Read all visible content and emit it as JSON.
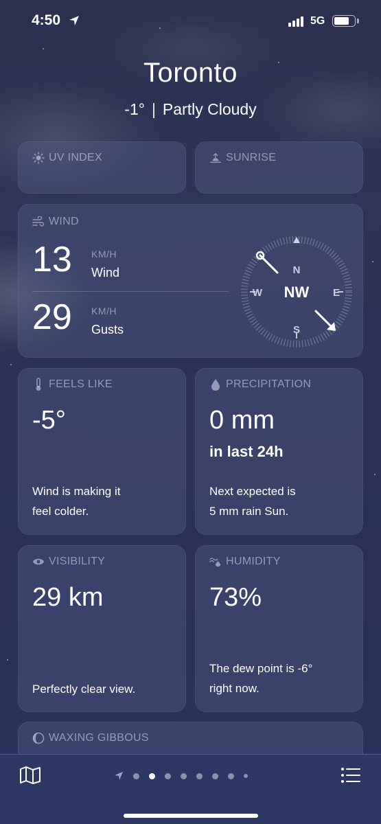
{
  "status_bar": {
    "time": "4:50",
    "network": "5G"
  },
  "header": {
    "city": "Toronto",
    "temperature": "-1°",
    "condition": "Partly Cloudy"
  },
  "cards": {
    "uv_index": {
      "title": "UV INDEX",
      "icon": "sun-icon"
    },
    "sunrise": {
      "title": "SUNRISE",
      "icon": "sunrise-icon"
    },
    "wind": {
      "title": "WIND",
      "icon": "wind-icon",
      "wind_value": "13",
      "wind_unit": "KM/H",
      "wind_label": "Wind",
      "gust_value": "29",
      "gust_unit": "KM/H",
      "gust_label": "Gusts",
      "direction": "NW",
      "compass": {
        "n": "N",
        "s": "S",
        "e": "E",
        "w": "W"
      }
    },
    "feels_like": {
      "title": "FEELS LIKE",
      "icon": "thermometer-icon",
      "value": "-5°",
      "description_line1": "Wind is making it",
      "description_line2": "feel colder."
    },
    "precipitation": {
      "title": "PRECIPITATION",
      "icon": "droplet-icon",
      "value": "0 mm",
      "subtitle": "in last 24h",
      "description_line1": "Next expected is",
      "description_line2": "5 mm rain Sun."
    },
    "visibility": {
      "title": "VISIBILITY",
      "icon": "eye-icon",
      "value": "29 km",
      "description": "Perfectly clear view."
    },
    "humidity": {
      "title": "HUMIDITY",
      "icon": "humidity-icon",
      "value": "73%",
      "description_line1": "The dew point is -6°",
      "description_line2": "right now."
    },
    "moon": {
      "title": "WAXING GIBBOUS",
      "icon": "moon-icon"
    }
  },
  "bottom_bar": {
    "page_count": 9,
    "active_page": 2
  },
  "colors": {
    "background": "#2b3157",
    "card": "#4a5382",
    "bottom_bar": "#2c3764",
    "accent_text": "#ffffff"
  }
}
